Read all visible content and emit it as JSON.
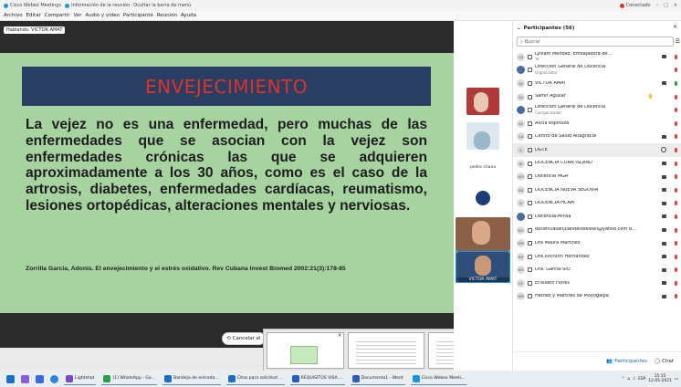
{
  "window": {
    "app_title": "Cisco Webex Meetings",
    "meeting_info": "Información de la reunión",
    "hide_menu": "Ocultar la barra de menú",
    "status": "Conectado",
    "colors": {
      "webex": "#1a96d6",
      "status_dot": "#e0322a"
    }
  },
  "menu": [
    "Archivo",
    "Editar",
    "Compartir",
    "Ver",
    "Audio y vídeo",
    "Participante",
    "Reunión",
    "Ayuda"
  ],
  "stage": {
    "speaking_label": "Hablando: VICTOR AMAT",
    "cancel_label": "Cancelar el"
  },
  "slide": {
    "title": "ENVEJECIMIENTO",
    "body": "La vejez no es una enfermedad, pero muchas de las enfermedades que se asocian con la vejez son enfermedades crónicas las que se adquieren aproximadamente a los 30 años, como es el caso de la artrosis, diabetes, enfermedades cardíacas, reumatismo, lesiones ortopédicas, alteraciones mentales y nerviosas.",
    "reference": "Zorrilla Garcia, Adonis. El envejecimiento y el estrés oxidativo. Rev Cubana Invest Biomed 2002:21(3):178-85",
    "colors": {
      "background": "#a6d3a0",
      "title_box": "#283e63",
      "title_text": "#e0322a"
    }
  },
  "videos": [
    {
      "name": ""
    },
    {
      "name": ""
    },
    {
      "name": "pedro chana"
    },
    {
      "name": ""
    },
    {
      "name": ""
    },
    {
      "name": "VICTOR AMAT"
    }
  ],
  "participants": {
    "header": "Participantes (56)",
    "search_placeholder": "Buscar",
    "list": [
      {
        "initials": "LN",
        "name": "Lylliam Méndez. Embajadora de...",
        "role": "Yo",
        "video": true,
        "mic": "muted"
      },
      {
        "initials": "",
        "name": "Dirección General de Docencia",
        "role": "Organizador",
        "video": false,
        "mic": "muted"
      },
      {
        "initials": "VA",
        "name": "VICTOR AMAT",
        "role": "",
        "video": true,
        "mic": "on"
      },
      {
        "initials": "SA",
        "name": "Samir Aguilar",
        "role": "",
        "video": false,
        "mic": "muted",
        "hand": true
      },
      {
        "initials": "",
        "name": "Dirección General de Docencia",
        "role": "Coorganizador",
        "video": false,
        "mic": "muted"
      },
      {
        "initials": "AE",
        "name": "Alicia espinoza",
        "role": "",
        "video": false,
        "mic": "muted"
      },
      {
        "initials": "CA",
        "name": "Centro de Salud Altagracia",
        "role": "",
        "video": true,
        "mic": "muted"
      },
      {
        "initials": "D",
        "name": "DGTE",
        "role": "",
        "video": false,
        "mic": "muted",
        "chat": true,
        "highlight": true
      },
      {
        "initials": "DI",
        "name": "DOCENCIA CORN ISLAND",
        "role": "",
        "video": true,
        "mic": "muted"
      },
      {
        "initials": "DM",
        "name": "Docencia MGA",
        "role": "",
        "video": true,
        "mic": "muted"
      },
      {
        "initials": "DS",
        "name": "DOCENCIA NUEVA SEGOVIA",
        "role": "",
        "video": true,
        "mic": "muted"
      },
      {
        "initials": "D",
        "name": "DOCENCIA-HCAM",
        "role": "",
        "video": true,
        "mic": "muted"
      },
      {
        "initials": "",
        "name": "Docencia-Minsa",
        "role": "",
        "video": true,
        "mic": "muted"
      },
      {
        "initials": "DO",
        "name": "docenciasanjuandelosestell@yahoo.com d...",
        "role": "",
        "video": true,
        "mic": "muted"
      },
      {
        "initials": "DM",
        "name": "Dra Maura Martinez",
        "role": "",
        "video": true,
        "mic": "muted"
      },
      {
        "initials": "DH",
        "name": "Dra Xochilth Hernandez",
        "role": "",
        "video": true,
        "mic": "muted"
      },
      {
        "initials": "DG",
        "name": "Dra. García-SIO",
        "role": "",
        "video": true,
        "mic": "muted"
      },
      {
        "initials": "EF",
        "name": "Erlisseth Flores",
        "role": "",
        "video": true,
        "mic": "muted"
      },
      {
        "initials": "HM",
        "name": "Heroes y Martires de Moyogalpa",
        "role": "",
        "video": true,
        "mic": "muted"
      }
    ],
    "bottom_participants": "Participantes",
    "bottom_chat": "Chat"
  },
  "taskbar": {
    "apps": [
      {
        "label": "Lightshot",
        "color": "#7a4cc4"
      },
      {
        "label": "(1) WhatsApp - Go...",
        "color": "#25a244"
      },
      {
        "label": "Bandeja de entrada...",
        "color": "#1a6fc4"
      },
      {
        "label": "Citas para solicitud ...",
        "color": "#1a6fc4"
      },
      {
        "label": "REQUISITOS VISA ...",
        "color": "#2b5cb8"
      },
      {
        "label": "Documento1 - Word",
        "color": "#2b5cb8"
      },
      {
        "label": "Cisco Webex Meeti...",
        "color": "#1a96d6"
      }
    ],
    "lang": "ESP",
    "time": "15:15",
    "date": "12-05-2021"
  }
}
